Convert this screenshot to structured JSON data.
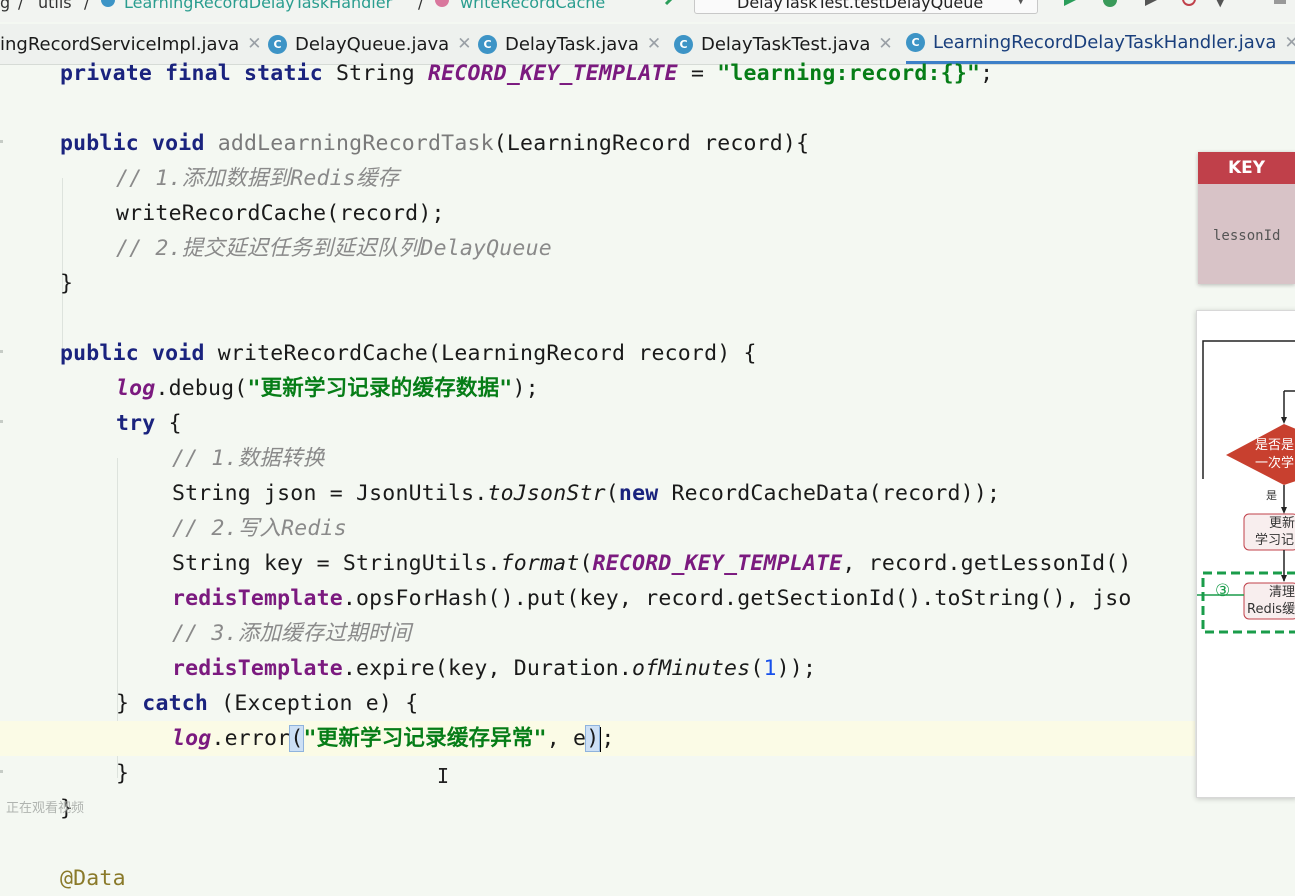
{
  "breadcrumb": {
    "items": [
      "g",
      "utils",
      "LearningRecordDelayTaskHandler",
      "writeRecordCache"
    ]
  },
  "toolbar": {
    "run_config": "DelayTaskTest.testDelayQueue"
  },
  "tabs": [
    {
      "label": "ingRecordServiceImpl.java",
      "active": false
    },
    {
      "label": "DelayQueue.java",
      "active": false
    },
    {
      "label": "DelayTask.java",
      "active": false
    },
    {
      "label": "DelayTaskTest.java",
      "active": false
    },
    {
      "label": "LearningRecordDelayTaskHandler.java",
      "active": true
    }
  ],
  "code": {
    "l1": {
      "a": "private final static ",
      "b": "String ",
      "c": "RECORD_KEY_TEMPLATE",
      "d": " = ",
      "e": "\"learning:record:{}\"",
      "f": ";"
    },
    "l3": {
      "a": "public void ",
      "b": "addLearningRecordTask",
      "c": "(LearningRecord record){"
    },
    "l4": "// 1.添加数据到Redis缓存",
    "l5": "writeRecordCache(record);",
    "l6": "// 2.提交延迟任务到延迟队列DelayQueue",
    "l7": "}",
    "l9": {
      "a": "public void ",
      "b": "writeRecordCache(LearningRecord record) {"
    },
    "l10": {
      "a": "log",
      "b": ".debug(",
      "c": "\"更新学习记录的缓存数据\"",
      "d": ");"
    },
    "l11": {
      "a": "try",
      "b": " {"
    },
    "l12": "// 1.数据转换",
    "l13": {
      "a": "String json = JsonUtils.",
      "b": "toJsonStr",
      "c": "(",
      "d": "new",
      "e": " RecordCacheData(record));"
    },
    "l14": "// 2.写入Redis",
    "l15": {
      "a": "String key = StringUtils.",
      "b": "format",
      "c": "(",
      "d": "RECORD_KEY_TEMPLATE",
      "e": ", record.getLessonId()"
    },
    "l16": {
      "a": "redisTemplate",
      "b": ".opsForHash().put(key, record.getSectionId().toString(), jso"
    },
    "l17": "// 3.添加缓存过期时间",
    "l18": {
      "a": "redisTemplate",
      "b": ".expire(key, Duration.",
      "c": "ofMinutes",
      "d": "(",
      "e": "1",
      "f": "));"
    },
    "l19": {
      "a": "} ",
      "b": "catch",
      "c": " (Exception e) {"
    },
    "l20": {
      "a": "log",
      "b": ".error",
      "c": "(",
      "d": "\"更新学习记录缓存异常\"",
      "e": ", e",
      "f": ")",
      "g": ";"
    },
    "l21": "}",
    "l22": "}",
    "l24": "@Data"
  },
  "diagram": {
    "key_header": "KEY",
    "key_cell": "lessonId",
    "decision_line1": "是否是",
    "decision_line2": "一次学",
    "yes_label": "是",
    "update_line1": "更新",
    "update_line2": "学习记",
    "step_number": "③",
    "clear_line1": "清理",
    "clear_line2": "Redis缓"
  },
  "watermark": "正在观看视频",
  "colors": {
    "editor_bg": "#f4f8f2",
    "keyword": "#1a237e",
    "string": "#067d17",
    "field": "#7b1a7f",
    "comment": "#8a8a8a",
    "key_header_bg": "#c0404a",
    "step_box_border": "#1a9c4a"
  }
}
